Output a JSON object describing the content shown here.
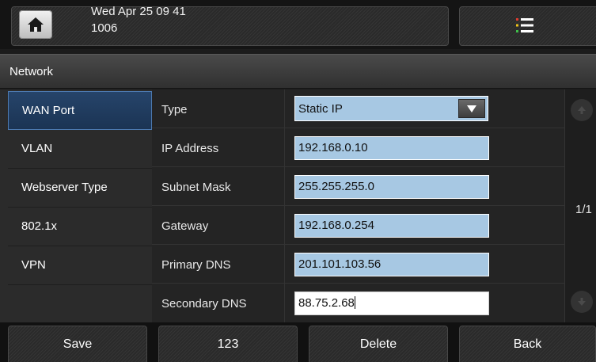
{
  "status": {
    "datetime": "Wed Apr 25 09 41",
    "extension": "1006"
  },
  "title": "Network",
  "sidebar": {
    "items": [
      {
        "label": "WAN Port",
        "active": true
      },
      {
        "label": "VLAN"
      },
      {
        "label": "Webserver Type"
      },
      {
        "label": "802.1x"
      },
      {
        "label": "VPN"
      },
      {
        "label": ""
      }
    ]
  },
  "form": {
    "type_label": "Type",
    "type_value": "Static IP",
    "ip_label": "IP Address",
    "ip_value": "192.168.0.10",
    "mask_label": "Subnet Mask",
    "mask_value": "255.255.255.0",
    "gateway_label": "Gateway",
    "gateway_value": "192.168.0.254",
    "dns1_label": "Primary DNS",
    "dns1_value": "201.101.103.56",
    "dns2_label": "Secondary DNS",
    "dns2_value": "88.75.2.68"
  },
  "pager": "1/1",
  "softkeys": {
    "save": "Save",
    "mode": "123",
    "delete": "Delete",
    "back": "Back"
  },
  "colors": {
    "field_fill": "#a7c8e3",
    "active_tab": "#26446a",
    "menu_dots": [
      "#e03b2f",
      "#f0c419",
      "#3fbf4a"
    ]
  }
}
